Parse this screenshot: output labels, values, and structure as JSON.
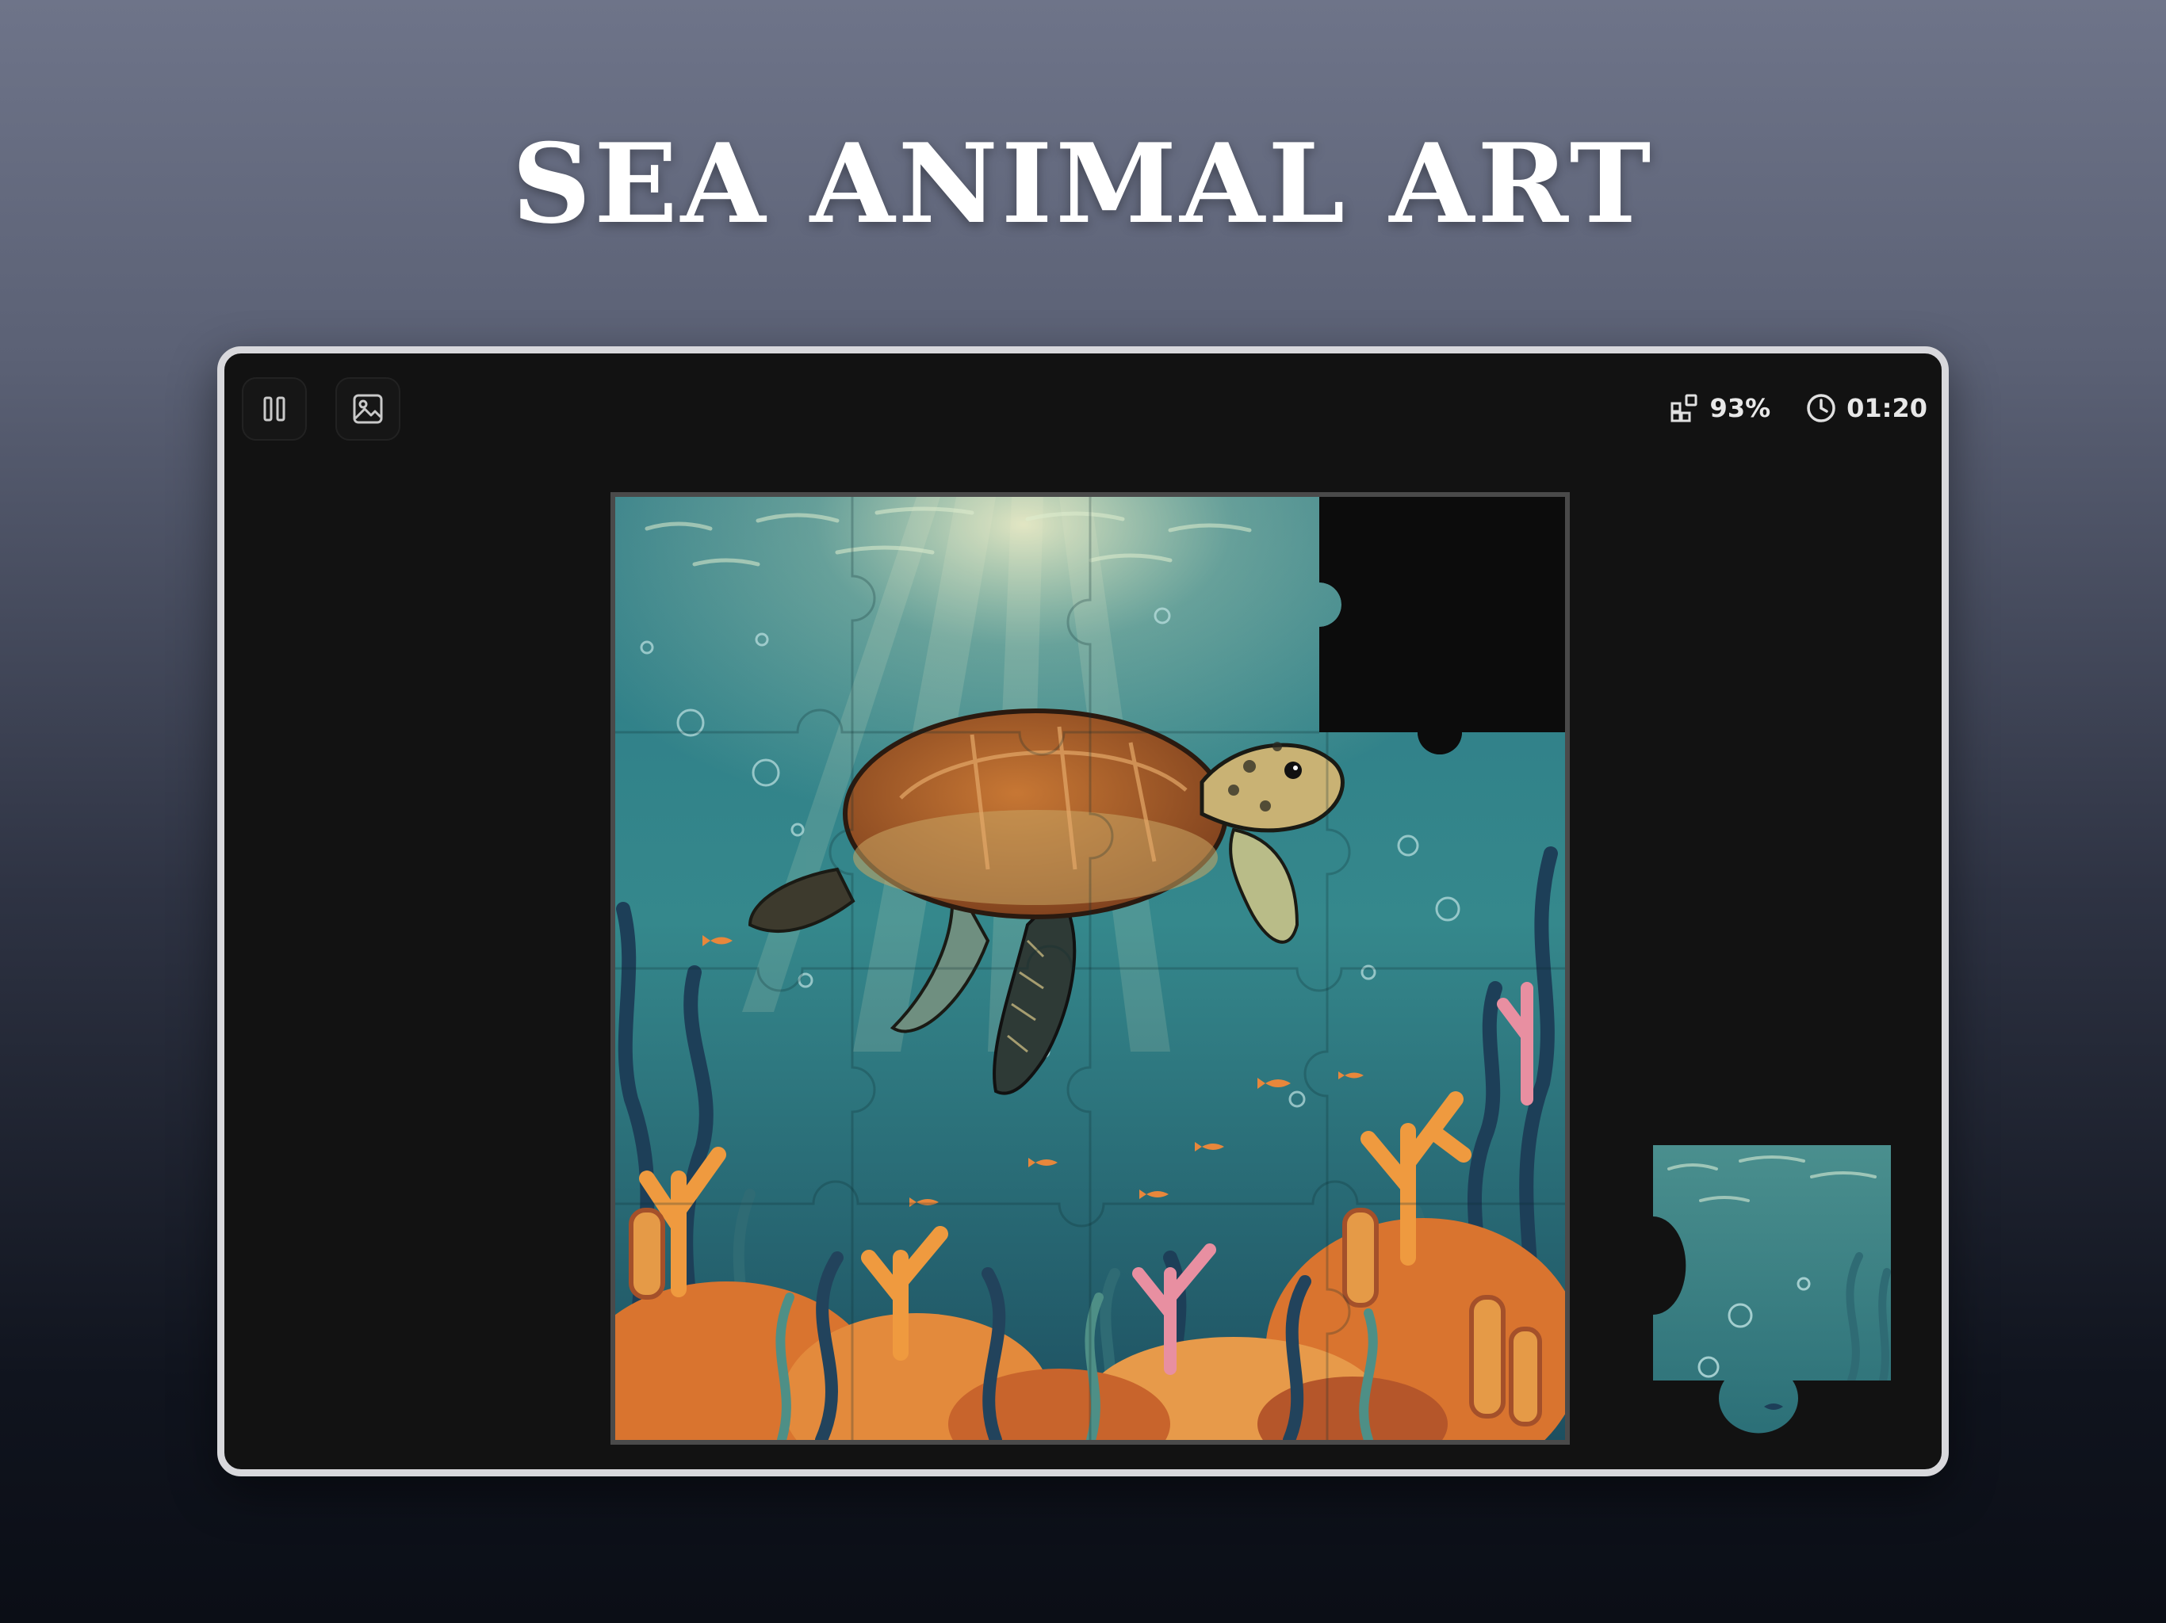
{
  "header": {
    "title": "SEA ANIMAL ART"
  },
  "toolbar": {
    "pause_icon": "pause-icon",
    "preview_icon": "image-icon"
  },
  "hud": {
    "progress_icon": "pieces-icon",
    "progress_text": "93%",
    "progress_value": 0.93,
    "timer_icon": "clock-icon",
    "timer_text": "01:20"
  },
  "puzzle": {
    "image_subject": "sea turtle swimming above coral reef",
    "grid": "4x4",
    "placed_pieces": 15,
    "missing_piece": "top-right",
    "colors": {
      "water": "#2f7f86",
      "deep_water": "#1f5a66",
      "turtle_shell": "#a4582a",
      "coral_orange": "#e38a3c",
      "coral_pink": "#e88fa1",
      "seaweed": "#1d3f58"
    }
  }
}
